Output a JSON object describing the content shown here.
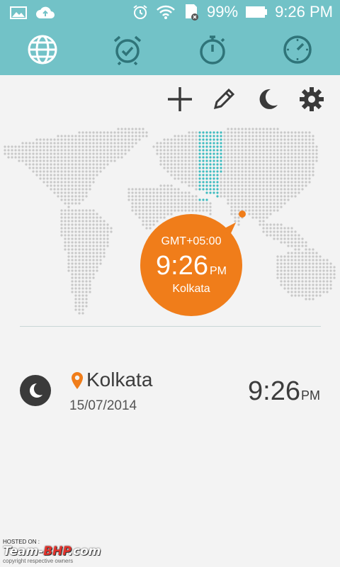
{
  "status_bar": {
    "battery_percent": "99%",
    "time": "9:26 PM",
    "icons": [
      "gallery-icon",
      "cloud-upload-icon",
      "alarm-icon",
      "wifi-icon",
      "sd-card-icon",
      "battery-icon"
    ]
  },
  "tabs": [
    {
      "name": "world-clock",
      "icon": "globe-icon",
      "active": true
    },
    {
      "name": "alarm",
      "icon": "alarm-clock-icon",
      "active": false
    },
    {
      "name": "stopwatch",
      "icon": "stopwatch-icon",
      "active": false
    },
    {
      "name": "timer",
      "icon": "timer-icon",
      "active": false
    }
  ],
  "toolbar": [
    "add-icon",
    "edit-icon",
    "night-mode-icon",
    "settings-icon"
  ],
  "map": {
    "bubble": {
      "gmt": "GMT+05:00",
      "time": "9:26",
      "ampm": "PM",
      "city": "Kolkata"
    }
  },
  "cities": [
    {
      "name": "Kolkata",
      "date": "15/07/2014",
      "time": "9:26",
      "ampm": "PM",
      "night": true
    }
  ],
  "watermark": {
    "hosted": "HOSTED ON :",
    "brand_a": "Team-",
    "brand_b": "BHP",
    "brand_c": ".com",
    "copyright": "copyright respective owners"
  },
  "colors": {
    "accent": "#72c2c7",
    "orange": "#f07d1a",
    "icon_dark": "#3a3a3a",
    "map_dot": "#c8c8c8",
    "highlight": "#3fbcc0"
  }
}
